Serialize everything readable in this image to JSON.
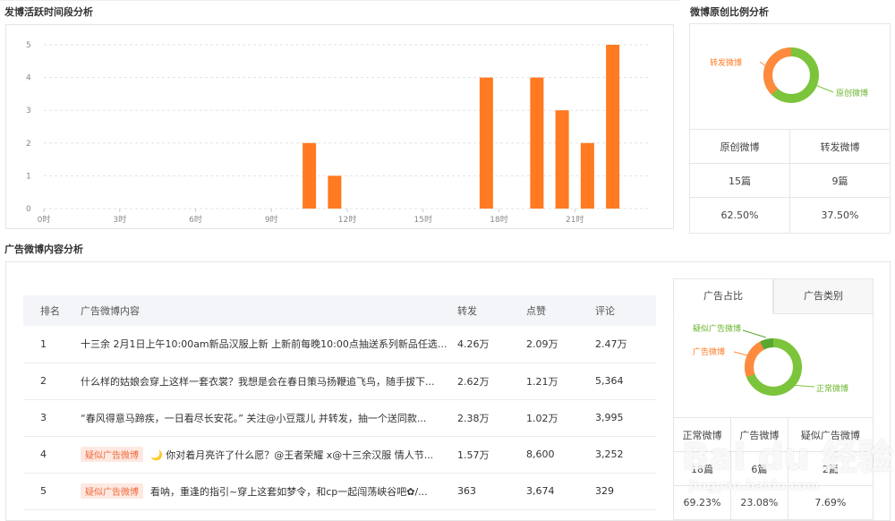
{
  "activity": {
    "title": "发博活跃时间段分析",
    "chart_data": {
      "type": "bar",
      "x": [
        0,
        1,
        2,
        3,
        4,
        5,
        6,
        7,
        8,
        9,
        10,
        11,
        12,
        13,
        14,
        15,
        16,
        17,
        18,
        19,
        20,
        21,
        22,
        23
      ],
      "values": [
        0,
        0,
        0,
        0,
        0,
        0,
        0,
        0,
        0,
        0,
        2,
        1,
        0,
        0,
        0,
        0,
        0,
        4,
        0,
        4,
        3,
        2,
        5,
        0
      ],
      "xtick_labels": [
        "0时",
        "3时",
        "6时",
        "9时",
        "12时",
        "15时",
        "18时",
        "21时"
      ],
      "ytick_labels": [
        "0",
        "1",
        "2",
        "3",
        "4",
        "5",
        "5"
      ],
      "ylim": [
        0,
        6
      ],
      "grid": true,
      "bar_color": "#ff7a21"
    }
  },
  "original": {
    "title": "微博原创比例分析",
    "donut_labels": {
      "repost": "转发微博",
      "original": "原创微博"
    },
    "chart_data": {
      "type": "pie",
      "labels": [
        "原创微博",
        "转发微博"
      ],
      "values": [
        62.5,
        37.5
      ],
      "colors": [
        "#7cc43b",
        "#ff8a3d"
      ]
    },
    "table": {
      "headers": [
        "原创微博",
        "转发微博"
      ],
      "counts": [
        "15篇",
        "9篇"
      ],
      "percents": [
        "62.50%",
        "37.50%"
      ]
    }
  },
  "ads": {
    "title": "广告微博内容分析",
    "headers": {
      "rank": "排名",
      "content": "广告微博内容",
      "repost": "转发",
      "like": "点赞",
      "comment": "评论"
    },
    "rows": [
      {
        "rank": "1",
        "tag": "",
        "content": "十三余 2月1日上午10:00am新品汉服上新 上新前每晚10:00点抽送系列新品任选...",
        "repost": "4.26万",
        "like": "2.09万",
        "comment": "2.47万"
      },
      {
        "rank": "2",
        "tag": "",
        "content": "什么样的姑娘会穿上这样一套衣裳？我想是会在春日策马扬鞭追飞鸟，随手拔下...",
        "repost": "2.62万",
        "like": "1.21万",
        "comment": "5,364"
      },
      {
        "rank": "3",
        "tag": "",
        "content": "“春风得意马蹄疾，一日看尽长安花。” 关注@小豆蔻儿 并转发，抽一个送同款...",
        "repost": "2.38万",
        "like": "1.02万",
        "comment": "3,995"
      },
      {
        "rank": "4",
        "tag": "疑似广告微博",
        "content": "🌙 你对着月亮许了什么愿？@王者荣耀 x@十三余汉服 情人节...",
        "repost": "1.57万",
        "like": "8,600",
        "comment": "3,252"
      },
      {
        "rank": "5",
        "tag": "疑似广告微博",
        "content": "看呐，重逢的指引~穿上这套如梦令，和cp一起闯荡峡谷吧✿/...",
        "repost": "363",
        "like": "3,674",
        "comment": "329"
      }
    ]
  },
  "ad_ratio": {
    "tabs": [
      "广告占比",
      "广告类别"
    ],
    "donut_labels": {
      "suspect": "疑似广告微博",
      "ad": "广告微博",
      "normal": "正常微博"
    },
    "chart_data": {
      "type": "pie",
      "labels": [
        "正常微博",
        "广告微博",
        "疑似广告微博"
      ],
      "values": [
        69.23,
        23.08,
        7.69
      ],
      "colors": [
        "#7cc43b",
        "#ff8a3d",
        "#5aa832"
      ]
    },
    "table": {
      "headers": [
        "正常微博",
        "广告微博",
        "疑似广告微博"
      ],
      "counts": [
        "18篇",
        "6篇",
        "2篇"
      ],
      "percents": [
        "69.23%",
        "23.08%",
        "7.69%"
      ]
    }
  },
  "watermark": {
    "brand": "Bai du 经验",
    "url": "jingyan.baidu.com"
  }
}
